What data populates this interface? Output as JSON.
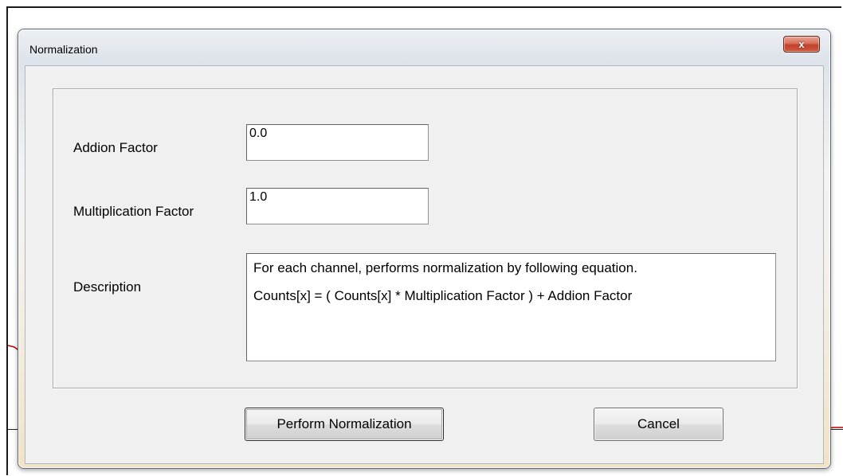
{
  "window": {
    "title": "Normalization",
    "close_glyph": "x"
  },
  "form": {
    "addition": {
      "label": "Addion Factor",
      "value": "0.0"
    },
    "multiplication": {
      "label": "Multiplication Factor",
      "value": "1.0"
    },
    "description": {
      "label": "Description",
      "lines": [
        "For each channel, performs normalization by following equation.",
        "Counts[x] = ( Counts[x] * Multiplication Factor ) + Addion Factor"
      ]
    }
  },
  "buttons": {
    "perform": "Perform Normalization",
    "cancel": "Cancel"
  },
  "icons": {
    "close": "close-icon"
  },
  "colors": {
    "close_button": "#c3412a",
    "background_trace": "#c00000"
  }
}
